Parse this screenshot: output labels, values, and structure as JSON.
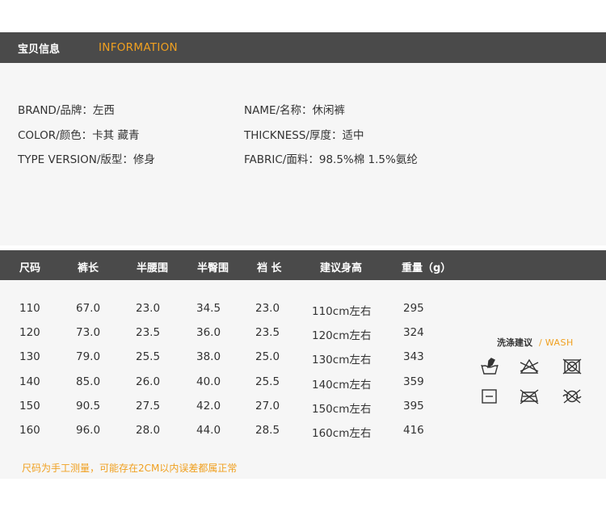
{
  "header": {
    "title_cn": "宝贝信息",
    "title_en": "INFORMATION"
  },
  "info": {
    "left": [
      "BRAND/品牌：左西",
      "COLOR/颜色：卡其 藏青",
      "TYPE VERSION/版型：修身"
    ],
    "right": [
      "NAME/名称：休闲裤",
      "THICKNESS/厚度：适中",
      "FABRIC/面料：98.5%棉 1.5%氨纶"
    ]
  },
  "size_table": {
    "headers": [
      "尺码",
      "裤长",
      "半腰围",
      "半臀围",
      "裆 长",
      "建议身高",
      "重量（g）"
    ],
    "rows": [
      [
        "110",
        "67.0",
        "23.0",
        "34.5",
        "23.0",
        "110cm左右",
        "295"
      ],
      [
        "120",
        "73.0",
        "23.5",
        "36.0",
        "23.5",
        "120cm左右",
        "324"
      ],
      [
        "130",
        "79.0",
        "25.5",
        "38.0",
        "25.0",
        "130cm左右",
        "343"
      ],
      [
        "140",
        "85.0",
        "26.0",
        "40.0",
        "25.5",
        "140cm左右",
        "359"
      ],
      [
        "150",
        "90.5",
        "27.5",
        "42.0",
        "27.0",
        "150cm左右",
        "395"
      ],
      [
        "160",
        "96.0",
        "28.0",
        "44.0",
        "28.5",
        "160cm左右",
        "416"
      ]
    ]
  },
  "wash": {
    "title_cn": "洗涤建议",
    "separator": "/",
    "title_en": "WASH",
    "icons": [
      "hand-wash-icon",
      "no-bleach-icon",
      "no-tumble-dry-icon",
      "line-dry-icon",
      "no-iron-icon",
      "no-dry-clean-icon"
    ]
  },
  "note": "尺码为手工测量，可能存在2CM以内误差都属正常",
  "colors": {
    "band": "#4a4a4a",
    "accent": "#f0a020",
    "panel": "#f6f6f6"
  }
}
